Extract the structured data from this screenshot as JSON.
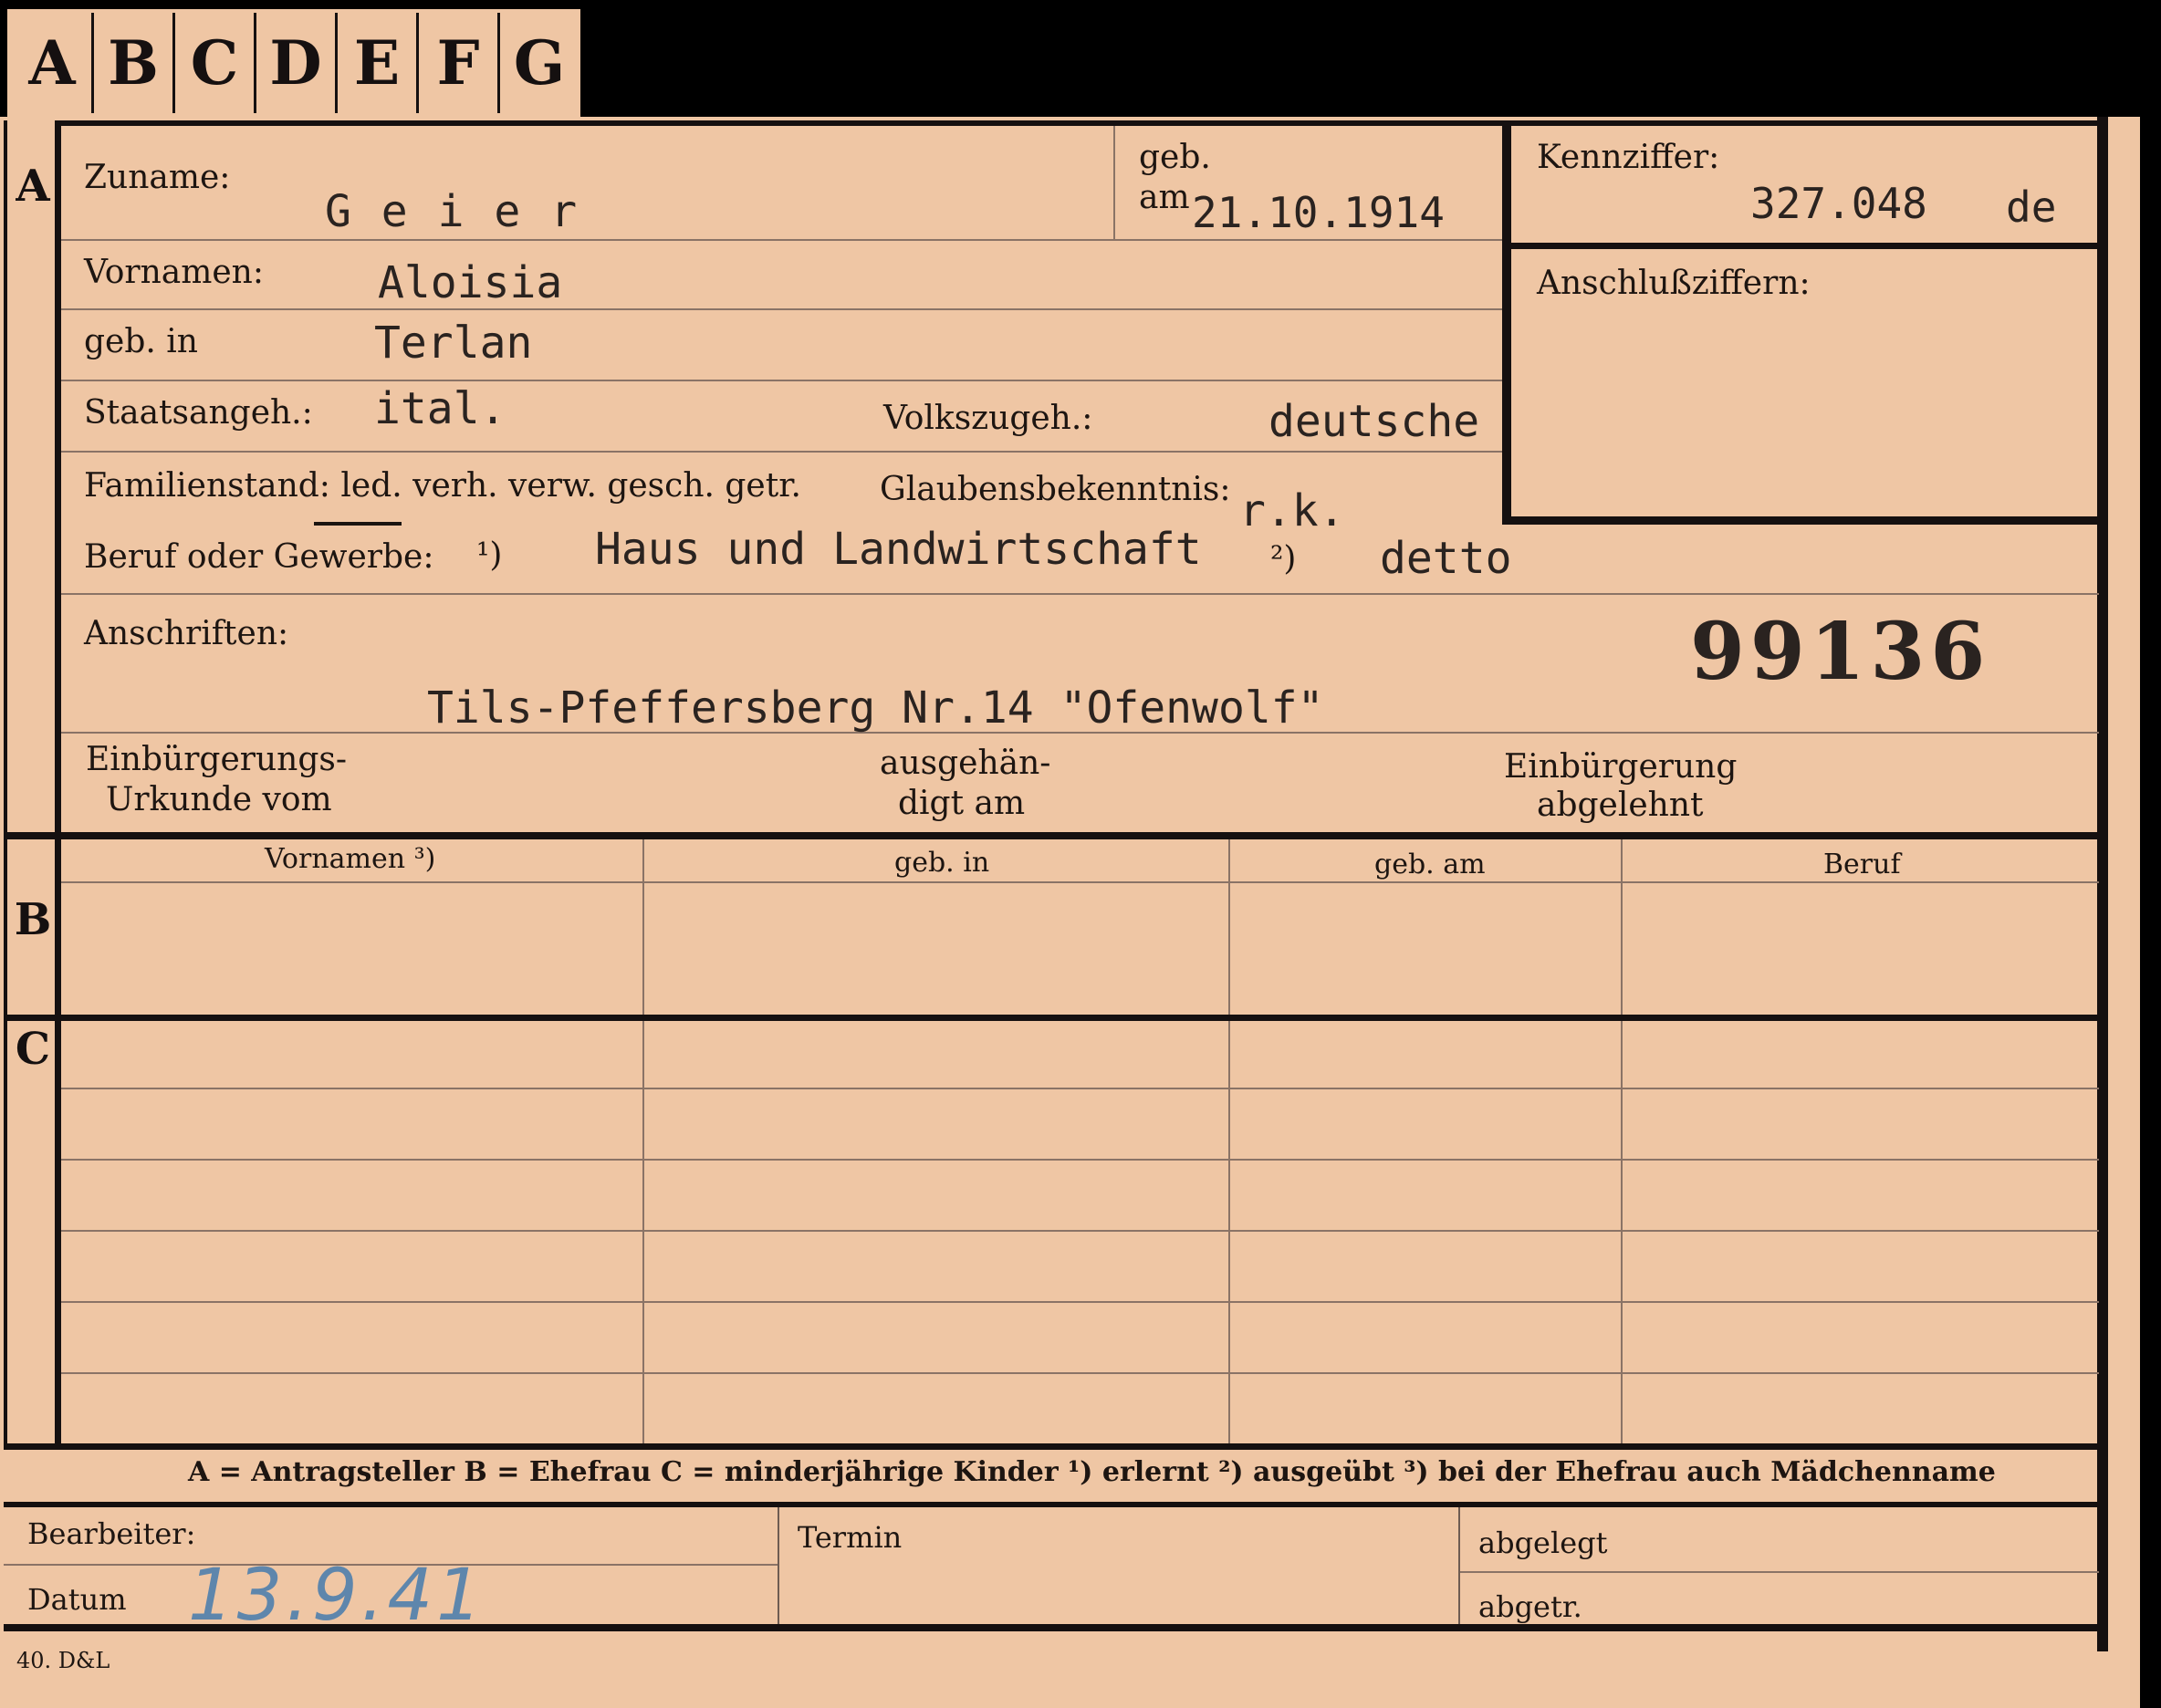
{
  "index_tabs": [
    "A",
    "B",
    "C",
    "D",
    "E",
    "F",
    "G"
  ],
  "section_letters": {
    "a": "A",
    "b": "B",
    "c": "C"
  },
  "labels": {
    "zuname": "Zuname:",
    "geb": "geb.",
    "am": "am",
    "kennziffer": "Kennziffer:",
    "vornamen": "Vornamen:",
    "anschlussziffern": "Anschlußziffern:",
    "geb_in": "geb. in",
    "staatsangeh": "Staatsangeh.:",
    "volkszugeh": "Volkszugeh.:",
    "familienstand": "Familienstand: led. verh. verw. gesch. getr.",
    "glaubensbekenntnis": "Glaubensbekenntnis:",
    "beruf": "Beruf oder Gewerbe:",
    "note1": "¹)",
    "note2": "²)",
    "anschriften": "Anschriften:",
    "einb_urkunde_1": "Einbürgerungs-",
    "einb_urkunde_2": "Urkunde vom",
    "ausgehaendigt_1": "ausgehän-",
    "ausgehaendigt_2": "digt am",
    "einb_abgelehnt_1": "Einbürgerung",
    "einb_abgelehnt_2": "abgelehnt",
    "bearbeiter": "Bearbeiter:",
    "datum": "Datum",
    "termin": "Termin",
    "abgelegt": "abgelegt",
    "abgetr": "abgetr."
  },
  "values": {
    "zuname": "G e i e r",
    "geb_am": "21.10.1914",
    "kennziffer": "327.048",
    "kennziffer_suffix": "de",
    "vornamen": "Aloisia",
    "geb_in": "Terlan",
    "staatsangeh": "ital.",
    "volkszugeh": "deutsche",
    "glaubensbekenntnis": "r.k.",
    "beruf_erlernt": "Haus und Landwirtschaft",
    "beruf_ausgeuebt": "detto",
    "stamp_number": "99136",
    "anschrift": "Tils-Pfeffersberg Nr.14 \"Ofenwolf\"",
    "datum": "13.9.41"
  },
  "table": {
    "headers": [
      "Vornamen ³)",
      "geb. in",
      "geb. am",
      "Beruf"
    ]
  },
  "legend": "A = Antragsteller   B = Ehefrau   C = minderjährige Kinder   ¹) erlernt   ²) ausgeübt   ³) bei der Ehefrau auch Mädchenname",
  "printer_mark": "40. D&L"
}
